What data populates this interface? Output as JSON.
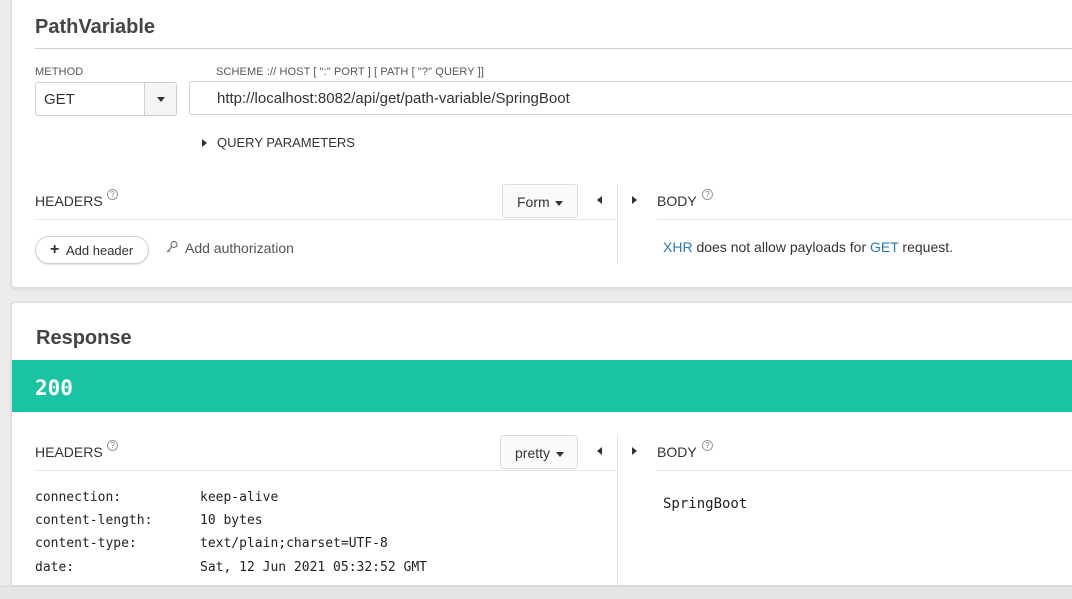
{
  "request": {
    "title": "PathVariable",
    "method_label": "METHOD",
    "method_value": "GET",
    "url_label": "SCHEME :// HOST [ \":\" PORT ] [ PATH [ \"?\" QUERY ]]",
    "url_value": "http://localhost:8082/api/get/path-variable/SpringBoot",
    "query_params_label": "QUERY PARAMETERS",
    "headers_label": "HEADERS",
    "headers_mode": "Form",
    "add_header_label": "Add header",
    "add_authorization_label": "Add authorization",
    "body_label": "BODY",
    "body_message": {
      "xhr": "XHR",
      "middle": " does not allow payloads for ",
      "method": "GET",
      "end": " request."
    }
  },
  "response": {
    "title": "Response",
    "status_code": "200",
    "status_color": "#1bc3a5",
    "headers_label": "HEADERS",
    "headers_mode": "pretty",
    "body_label": "BODY",
    "headers": [
      {
        "key": "connection:",
        "value": "keep-alive"
      },
      {
        "key": "content-length:",
        "value": "10 bytes"
      },
      {
        "key": "content-type:",
        "value": "text/plain;charset=UTF-8"
      },
      {
        "key": "date:",
        "value": "Sat, 12 Jun 2021 05:32:52 GMT"
      }
    ],
    "body_content": "SpringBoot"
  },
  "icons": {
    "help": "question-circle-icon",
    "expand": "triangle-right-icon",
    "collapse": "triangle-left-icon",
    "dropdown": "caret-down-icon",
    "key": "key-icon",
    "plus": "plus-icon"
  }
}
